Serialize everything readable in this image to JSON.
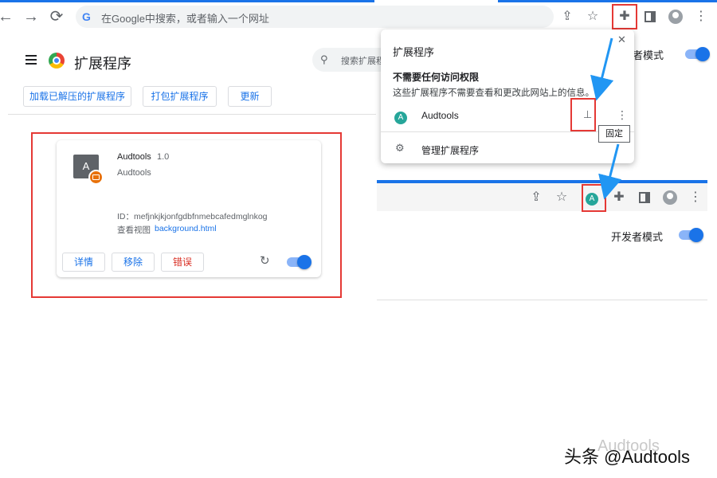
{
  "toolbar": {
    "back_glyph": "←",
    "forward_glyph": "→",
    "reload_glyph": "⟳",
    "omnibox_g": "G",
    "omnibox_placeholder": "在Google中搜索，或者输入一个网址",
    "share_glyph": "⇪",
    "star_glyph": "☆",
    "puzzle_glyph": "✚",
    "menu_glyph": "⋮"
  },
  "extensions_page": {
    "title": "扩展程序",
    "search_placeholder": "搜索扩展程序",
    "search_glyph": "🔍",
    "buttons": [
      "加载已解压的扩展程序",
      "打包扩展程序",
      "更新"
    ],
    "dev_mode_label": "开发者模式",
    "dev_mode_partial": "者模式"
  },
  "extension_card": {
    "icon_letter": "A",
    "name": "Audtools",
    "version": "1.0",
    "description": "Audtools",
    "id_line": "ID：mefjnkjkjonfgdbfnmebcafedmglnkog",
    "views_label": "查看视图",
    "views_link": "background.html",
    "actions": [
      "详情",
      "移除",
      "错误"
    ],
    "reload_glyph": "↻",
    "enabled": true
  },
  "popup": {
    "title": "扩展程序",
    "close_glyph": "✕",
    "section_heading": "不需要任何访问权限",
    "section_desc": "这些扩展程序不需要查看和更改此网站上的信息。",
    "item_icon_letter": "A",
    "item_name": "Audtools",
    "pin_glyph": "⊥",
    "item_menu_glyph": "⋮",
    "manage_glyph": "⚙",
    "manage_label": "管理扩展程序",
    "pin_tooltip": "固定"
  },
  "after_pin_toolbar": {
    "pinned_icon_letter": "A",
    "dev_mode_label": "开发者模式"
  },
  "watermark": {
    "text": "头条 @Audtools",
    "faded": "Audtools"
  },
  "colors": {
    "accent": "#1a73e8",
    "highlight_red": "#e53935",
    "callout_arrow": "#2196f3",
    "ext_badge": "#e8710a",
    "pinned_icon": "#26a69a"
  }
}
